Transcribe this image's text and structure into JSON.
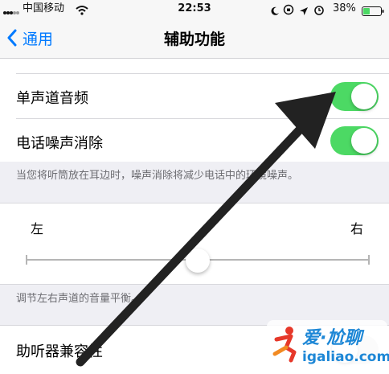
{
  "status_bar": {
    "carrier": "中国移动",
    "time": "22:53",
    "battery": "38%"
  },
  "nav": {
    "back_label": "通用",
    "title": "辅助功能"
  },
  "rows": {
    "mono_audio": {
      "label": "单声道音频",
      "on": true
    },
    "phone_noise": {
      "label": "电话噪声消除",
      "on": true
    },
    "noise_note": "当您将听筒放在耳边时，噪声消除将减少电话中的环境噪声。"
  },
  "balance": {
    "left_label": "左",
    "right_label": "右",
    "value": 0.5,
    "note": "调节左右声道的音量平衡。"
  },
  "hearing": {
    "label": "助听器兼容性"
  },
  "watermark": {
    "text_cn": "爱·尬聊",
    "text_domain": "igaliao.com"
  },
  "colors": {
    "accent": "#007aff",
    "toggle_on": "#4cd964",
    "arrow": "#222222"
  }
}
